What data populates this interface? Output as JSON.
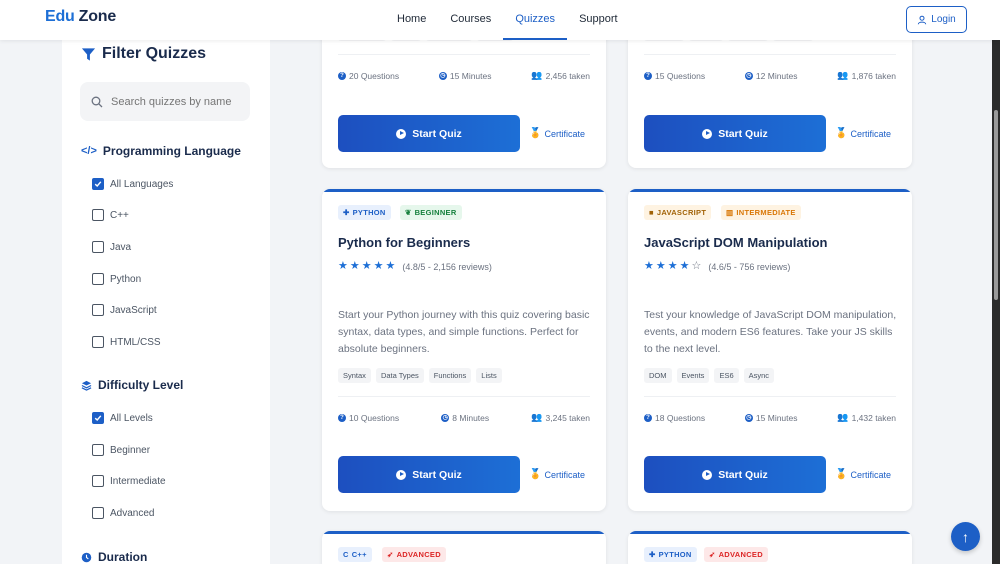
{
  "brand": {
    "part1": "Edu",
    "part2": "Zone"
  },
  "nav": [
    {
      "label": "Home"
    },
    {
      "label": "Courses"
    },
    {
      "label": "Quizzes"
    },
    {
      "label": "Support"
    }
  ],
  "header": {
    "login_label": "Login"
  },
  "sidebar": {
    "title": "Filter Quizzes",
    "search_placeholder": "Search quizzes by name...",
    "language_title": "Programming Language",
    "languages": [
      "All Languages",
      "C++",
      "Java",
      "Python",
      "JavaScript",
      "HTML/CSS"
    ],
    "difficulty_title": "Difficulty Level",
    "difficulties": [
      "All Levels",
      "Beginner",
      "Intermediate",
      "Advanced"
    ],
    "duration_title": "Duration"
  },
  "cards_top": [
    {
      "questions": "20 Questions",
      "time": "15 Minutes",
      "taken": "2,456 taken",
      "start": "Start Quiz",
      "cert": "Certificate"
    },
    {
      "questions": "15 Questions",
      "time": "12 Minutes",
      "taken": "1,876 taken",
      "start": "Start Quiz",
      "cert": "Certificate"
    }
  ],
  "cards_mid": [
    {
      "lang": "PYTHON",
      "level": "BEGINNER",
      "title": "Python for Beginners",
      "rating": "(4.8/5 - 2,156 reviews)",
      "desc": "Start your Python journey with this quiz covering basic syntax, data types, and simple functions. Perfect for absolute beginners.",
      "tags": [
        "Syntax",
        "Data Types",
        "Functions",
        "Lists"
      ],
      "questions": "10 Questions",
      "time": "8 Minutes",
      "taken": "3,245 taken",
      "start": "Start Quiz",
      "cert": "Certificate"
    },
    {
      "lang": "JAVASCRIPT",
      "level": "INTERMEDIATE",
      "title": "JavaScript DOM Manipulation",
      "rating": "(4.6/5 - 756 reviews)",
      "desc": "Test your knowledge of JavaScript DOM manipulation, events, and modern ES6 features. Take your JS skills to the next level.",
      "tags": [
        "DOM",
        "Events",
        "ES6",
        "Async"
      ],
      "questions": "18 Questions",
      "time": "15 Minutes",
      "taken": "1,432 taken",
      "start": "Start Quiz",
      "cert": "Certificate"
    }
  ],
  "cards_bottom": [
    {
      "lang": "C++",
      "level": "ADVANCED"
    },
    {
      "lang": "PYTHON",
      "level": "ADVANCED"
    }
  ],
  "back_to_top": "↑"
}
